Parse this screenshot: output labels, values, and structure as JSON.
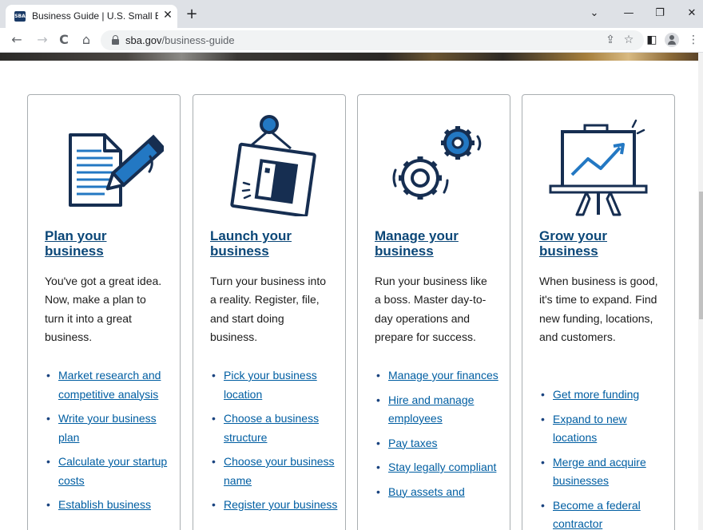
{
  "browser": {
    "tab_title": "Business Guide | U.S. Small Busin",
    "tab_favicon_text": "SBA",
    "close_glyph": "✕",
    "new_tab_glyph": "+",
    "win_minimize": "—",
    "win_restore": "❐",
    "win_close": "✕",
    "win_menu": "⌄",
    "back": "←",
    "forward": "→",
    "reload": "C",
    "home": "⌂",
    "url_host": "sba.gov",
    "url_path": "/business-guide",
    "share_icon": "⇪",
    "star_icon": "☆",
    "sidepanel_icon": "◧",
    "menu_icon": "⋮"
  },
  "cards": [
    {
      "title": "Plan your business",
      "description": "You've got a great idea. Now, make a plan to turn it into a great business.",
      "links": [
        "Market research and competitive analysis",
        "Write your business plan",
        "Calculate your startup costs",
        "Establish business"
      ]
    },
    {
      "title": "Launch your business",
      "description": "Turn your business into a reality. Register, file, and start doing business.",
      "links": [
        "Pick your business location",
        "Choose a business structure",
        "Choose your business name",
        "Register your business"
      ]
    },
    {
      "title": "Manage your business",
      "description": "Run your business like a boss. Master day-to-day operations and prepare for success.",
      "links": [
        "Manage your finances",
        "Hire and manage employees",
        "Pay taxes",
        "Stay legally compliant",
        "Buy assets and"
      ]
    },
    {
      "title": "Grow your business",
      "description": "When business is good, it's time to expand. Find new funding, locations, and customers.",
      "links": [
        "Get more funding",
        "Expand to new locations",
        "Merge and acquire businesses",
        "Become a federal contractor"
      ]
    }
  ],
  "colors": {
    "title_link": "#0b4778",
    "body_link": "#005ea2",
    "icon_navy": "#162e51",
    "icon_blue": "#2378c3"
  }
}
